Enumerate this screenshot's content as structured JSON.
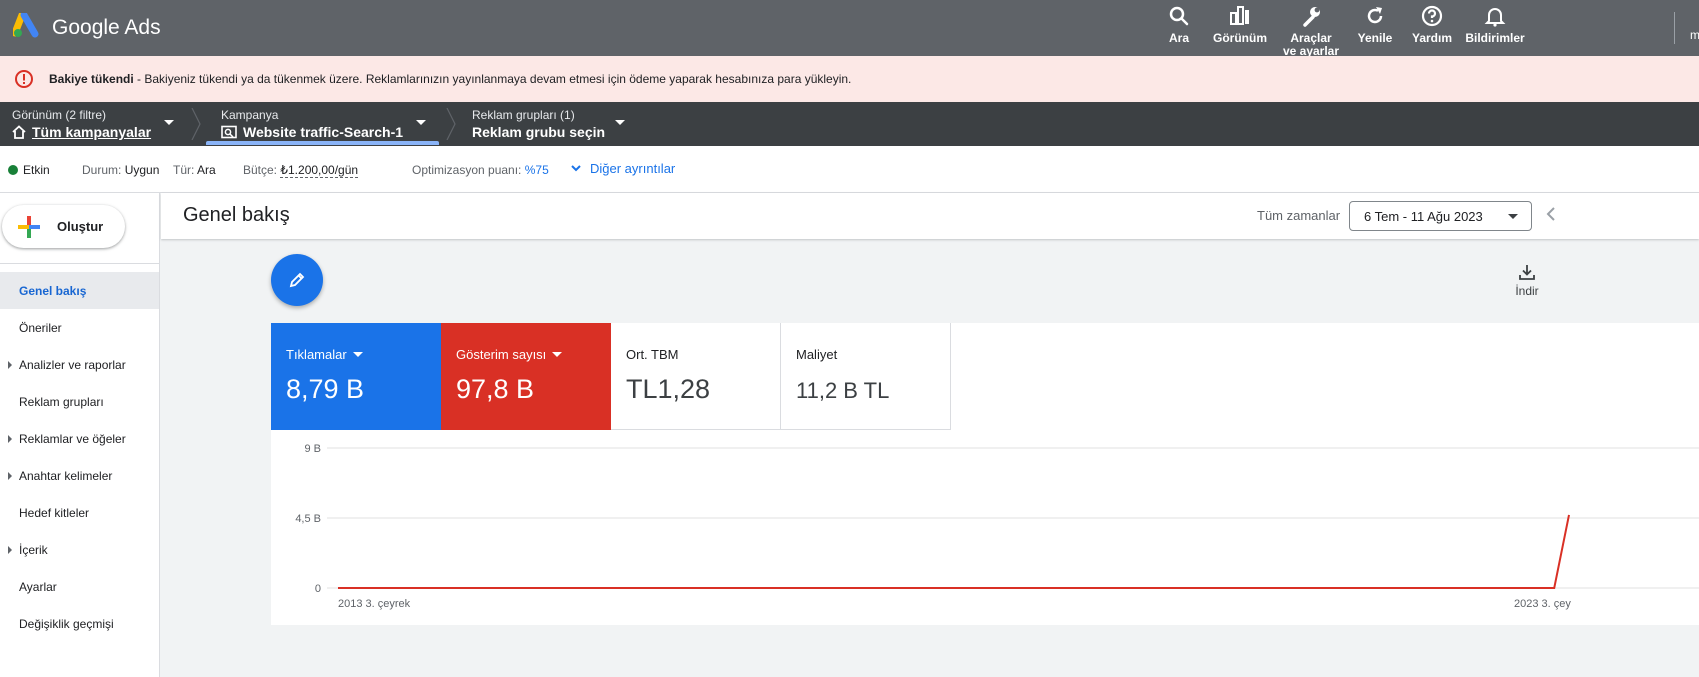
{
  "app": {
    "title": "Google Ads"
  },
  "header": {
    "actions": [
      {
        "label": "Ara",
        "icon": "search-icon"
      },
      {
        "label": "Görünüm",
        "icon": "appearance-icon"
      },
      {
        "label": "Araçlar",
        "label2": "ve ayarlar",
        "icon": "wrench-icon"
      },
      {
        "label": "Yenile",
        "icon": "refresh-icon"
      },
      {
        "label": "Yardım",
        "icon": "help-icon"
      },
      {
        "label": "Bildirimler",
        "icon": "bell-icon"
      }
    ],
    "user_initial": "m"
  },
  "alert": {
    "title": "Bakiye tükendi",
    "message": " - Bakiyeniz tükendi ya da tükenmek üzere. Reklamlarınızın yayınlanmaya devam etmesi için ödeme yaparak hesabınıza para yükleyin."
  },
  "breadcrumbs": {
    "view_label": "Görünüm (2 filtre)",
    "view_value": "Tüm kampanyalar",
    "campaign_label": "Kampanya",
    "campaign_value": "Website traffic-Search-1",
    "adgroup_label": "Reklam grupları (1)",
    "adgroup_value": "Reklam grubu seçin"
  },
  "status": {
    "state": "Etkin",
    "durum_label": "Durum:",
    "durum_value": "Uygun",
    "tur_label": "Tür:",
    "tur_value": "Ara",
    "butce_label": "Bütçe:",
    "butce_value": "₺1.200,00/gün",
    "opt_label": "Optimizasyon puanı:",
    "opt_value": "%75",
    "more_details": "Diğer ayrıntılar"
  },
  "sidebar": {
    "create_label": "Oluştur",
    "items": [
      {
        "label": "Genel bakış",
        "active": true,
        "expandable": false
      },
      {
        "label": "Öneriler",
        "active": false,
        "expandable": false
      },
      {
        "label": "Analizler ve raporlar",
        "active": false,
        "expandable": true
      },
      {
        "label": "Reklam grupları",
        "active": false,
        "expandable": false
      },
      {
        "label": "Reklamlar ve öğeler",
        "active": false,
        "expandable": true
      },
      {
        "label": "Anahtar kelimeler",
        "active": false,
        "expandable": true
      },
      {
        "label": "Hedef kitleler",
        "active": false,
        "expandable": false
      },
      {
        "label": "İçerik",
        "active": false,
        "expandable": true
      },
      {
        "label": "Ayarlar",
        "active": false,
        "expandable": false
      },
      {
        "label": "Değişiklik geçmişi",
        "active": false,
        "expandable": false
      }
    ]
  },
  "main": {
    "title": "Genel bakış",
    "time_label": "Tüm zamanlar",
    "date_range": "6 Tem - 11 Ağu 2023",
    "download_label": "İndir"
  },
  "metrics": [
    {
      "name": "Tıklamalar",
      "value": "8,79 B",
      "color": "#1a73e8",
      "dropdown": true
    },
    {
      "name": "Gösterim sayısı",
      "value": "97,8 B",
      "color": "#d93025",
      "dropdown": true
    },
    {
      "name": "Ort. TBM",
      "value": "TL1,28",
      "color": "#ffffff",
      "dropdown": false
    },
    {
      "name": "Maliyet",
      "value": "11,2 B TL",
      "color": "#ffffff",
      "dropdown": false
    }
  ],
  "chart_data": {
    "type": "line",
    "y_ticks": [
      "9 B",
      "4,5 B",
      "0"
    ],
    "ylim": [
      0,
      9
    ],
    "x_labels": [
      "2013 3. çeyrek",
      "2023 3. çey"
    ],
    "x": [
      0,
      0.988,
      1
    ],
    "series": [
      {
        "color": "#d93025",
        "values": [
          0,
          0,
          4.7
        ]
      }
    ],
    "grid": true
  },
  "colors": {
    "header_bg": "#5f6368",
    "alert_bg": "#fce8e6",
    "breadcrumb_bg": "#3c4043",
    "accent_blue": "#1a73e8",
    "accent_red": "#d93025",
    "status_green": "#188038"
  }
}
